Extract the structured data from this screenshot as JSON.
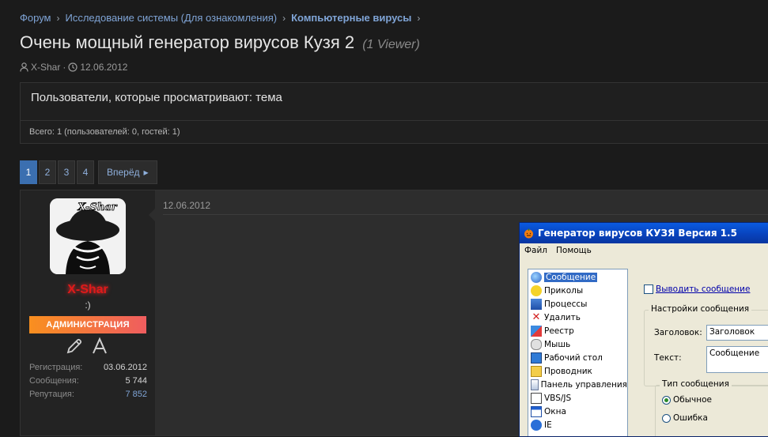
{
  "breadcrumb": {
    "items": [
      "Форум",
      "Исследование системы (Для ознакомления)",
      "Компьютерные вирусы"
    ]
  },
  "thread": {
    "title": "Очень мощный генератор вирусов Кузя 2",
    "viewers": "(1 Viewer)",
    "author": "X-Shar",
    "date": "12.06.2012"
  },
  "viewers_box": {
    "heading": "Пользователи, которые просматривают: тема",
    "summary": "Всего: 1 (пользователей: 0, гостей: 1)"
  },
  "pagination": {
    "pages": [
      "1",
      "2",
      "3",
      "4"
    ],
    "current": "1",
    "next_label": "Вперёд"
  },
  "post": {
    "date": "12.06.2012",
    "user": {
      "avatar_text": "X-Shar",
      "name": "X-Shar",
      "title": ":)",
      "banner": "АДМИНИСТРАЦИЯ",
      "stats": [
        {
          "label": "Регистрация:",
          "value": "03.06.2012"
        },
        {
          "label": "Сообщения:",
          "value": "5 744"
        },
        {
          "label": "Репутация:",
          "value": "7 852"
        }
      ]
    }
  },
  "embedded_app": {
    "title": "Генератор вирусов КУЗЯ Версия 1.5",
    "menu": [
      "Файл",
      "Помощь"
    ],
    "list": [
      "Сообщение",
      "Приколы",
      "Процессы",
      "Удалить",
      "Реестр",
      "Мышь",
      "Рабочий стол",
      "Проводник",
      "Панель управления",
      "VBS/JS",
      "Окна",
      "IE"
    ],
    "selected": "Сообщение",
    "checkbox_label": "Выводить сообщение",
    "group_title": "Настройки сообщения",
    "header_label": "Заголовок:",
    "header_value": "Заголовок",
    "text_label": "Текст:",
    "text_value": "Сообщение",
    "type_group_title": "Тип сообщения",
    "radio_options": [
      "Обычное",
      "Ошибка"
    ]
  },
  "colors": {
    "background": "#1b1b1b",
    "link": "#7fa4d6",
    "active_page": "#3b6fb0",
    "username": "#e01a1a",
    "banner_start": "#f98f1f",
    "banner_end": "#ef5d5f"
  }
}
